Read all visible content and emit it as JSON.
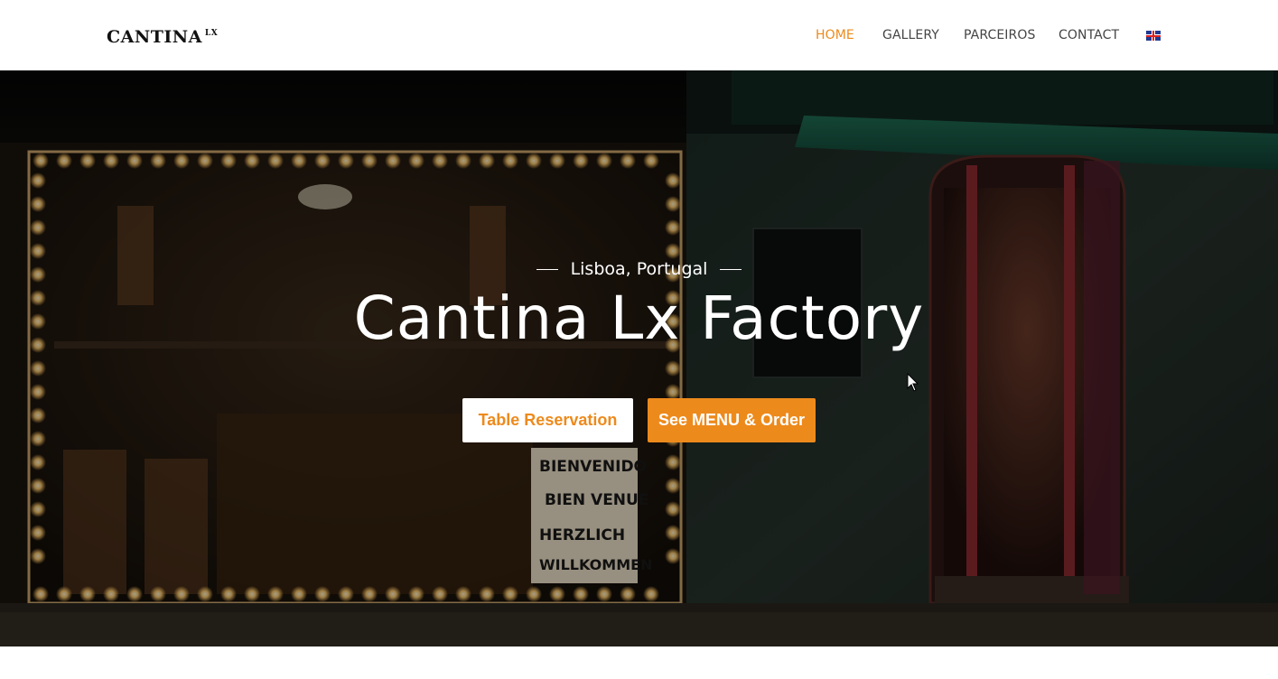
{
  "header": {
    "logo_text": "CANTINA",
    "logo_sup": "LX",
    "nav": [
      {
        "label": "HOME",
        "active": true
      },
      {
        "label": "GALLERY",
        "active": false
      },
      {
        "label": "PARCEIROS",
        "active": false
      },
      {
        "label": "CONTACT",
        "active": false
      }
    ],
    "language_icon": "uk-flag-icon"
  },
  "hero": {
    "subtitle": "Lisboa, Portugal",
    "title": "Cantina Lx Factory",
    "buttons": {
      "reservation": "Table Reservation",
      "menu": "See MENU & Order"
    },
    "sign_text": [
      "BIENVENIDO",
      "BIEN VENUE",
      "HERZLICH",
      "WILLKOMMEN"
    ]
  },
  "colors": {
    "accent": "#ed8a1c",
    "nav_text": "#444444",
    "header_bg": "#ffffff"
  }
}
